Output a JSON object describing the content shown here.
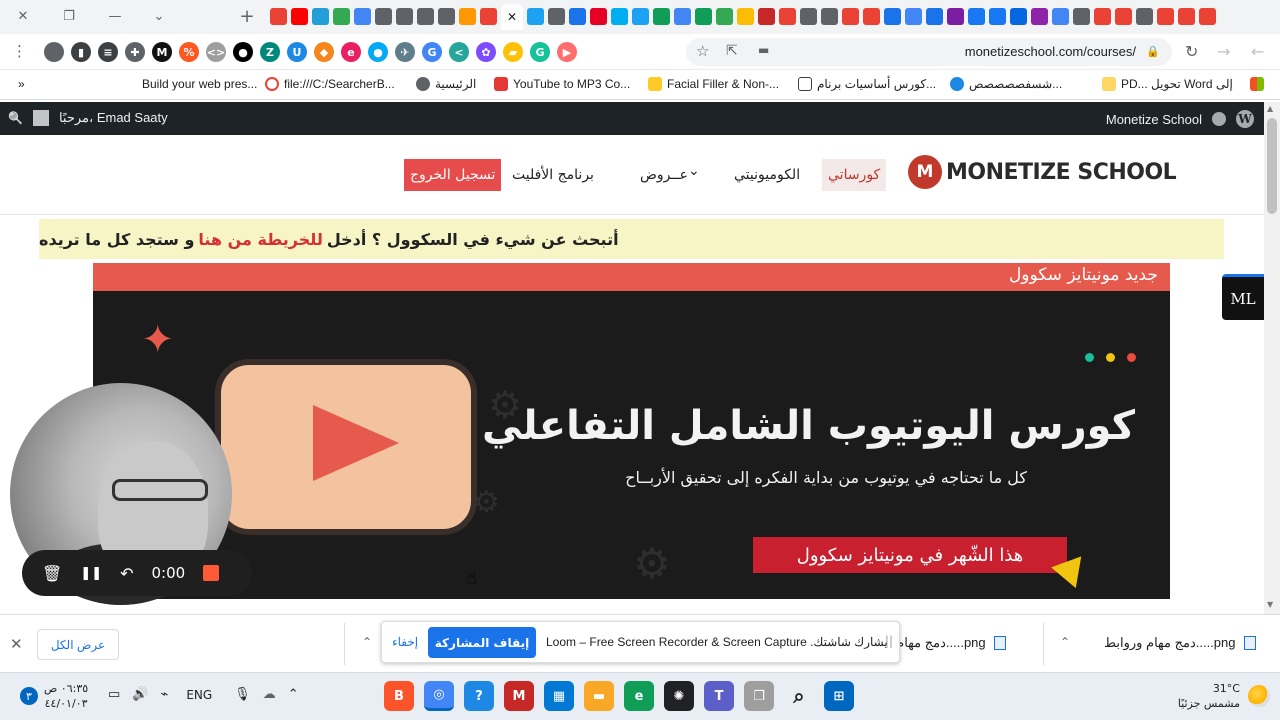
{
  "window": {
    "close_symbol": "✕",
    "restore_symbol": "❐",
    "minimize_symbol": "—",
    "tab_list_symbol": "⌄",
    "new_tab_symbol": "+",
    "active_tab_close_symbol": "✕"
  },
  "tabs": {
    "favicon_colors": [
      "#ea4335",
      "#ff0000",
      "#229ed9",
      "#34a853",
      "#4285f4",
      "#5f6368",
      "#5f6368",
      "#5f6368",
      "#5f6368",
      "#ff9800",
      "#ea4335",
      "#ffffff",
      "#1da1f2",
      "#5f6368",
      "#1a73e8",
      "#e60023",
      "#00aff0",
      "#1da1f2",
      "#0f9d58",
      "#4285f4",
      "#0f9d58",
      "#34a853",
      "#fbbc04",
      "#c62828",
      "#ea4335",
      "#5f6368",
      "#5f6368",
      "#ea4335",
      "#ea4335",
      "#1a73e8",
      "#4285f4",
      "#1a73e8",
      "#7b1fa2",
      "#1877f2",
      "#1877f2",
      "#0668e1",
      "#8e24aa",
      "#4285f4",
      "#5f6368",
      "#ea4335",
      "#ea4335",
      "#5f6368",
      "#ea4335",
      "#ea4335",
      "#ea4335"
    ]
  },
  "toolbar": {
    "url": "monetizeschool.com/courses/",
    "star_symbol": "☆",
    "share_symbol": "⇱",
    "cast_symbol": "▬",
    "lock_symbol": "🔒",
    "reload_symbol": "↻",
    "back_symbol": "←",
    "forward_symbol": "→",
    "menu_symbol": "⋮",
    "extensions": [
      {
        "name": "profile-extension-icon",
        "color": "#5f6368",
        "glyph": ""
      },
      {
        "name": "sidepanel-icon",
        "color": "#3c4043",
        "glyph": "▮"
      },
      {
        "name": "reading-list-icon",
        "color": "#3c4043",
        "glyph": "≡"
      },
      {
        "name": "puzzle-icon",
        "color": "#5f6368",
        "glyph": "✚"
      },
      {
        "name": "loom-icon",
        "color": "#111111",
        "glyph": "M"
      },
      {
        "name": "percent-icon",
        "color": "#ff5722",
        "glyph": "%"
      },
      {
        "name": "code-icon",
        "color": "#9e9e9e",
        "glyph": "<>"
      },
      {
        "name": "dot-icon",
        "color": "#000000",
        "glyph": "●"
      },
      {
        "name": "z-icon",
        "color": "#00897b",
        "glyph": "Z"
      },
      {
        "name": "u-icon",
        "color": "#1e88e5",
        "glyph": "U"
      },
      {
        "name": "metamask-icon",
        "color": "#f6851b",
        "glyph": "◆"
      },
      {
        "name": "e-icon",
        "color": "#e91e63",
        "glyph": "e"
      },
      {
        "name": "drop-icon",
        "color": "#03a9f4",
        "glyph": "●"
      },
      {
        "name": "bird-icon",
        "color": "#607d8b",
        "glyph": "✈"
      },
      {
        "name": "translate-icon",
        "color": "#4285f4",
        "glyph": "G"
      },
      {
        "name": "share-dots-icon",
        "color": "#26a69a",
        "glyph": "<"
      },
      {
        "name": "flower-icon",
        "color": "#7c4dff",
        "glyph": "✿"
      },
      {
        "name": "lamp-icon",
        "color": "#ffc107",
        "glyph": "▰"
      },
      {
        "name": "grammarly-icon",
        "color": "#15c39a",
        "glyph": "G"
      },
      {
        "name": "video-icon",
        "color": "#ff6d6d",
        "glyph": "▶"
      }
    ]
  },
  "bookmarks": {
    "overflow": "»",
    "items": [
      {
        "label": "Build your web pres...",
        "color": "#ffffff"
      },
      {
        "label": "file:///C:/SearcherB...",
        "color": "#ea4335"
      },
      {
        "label": "الرئيسية",
        "color": "#5f6368"
      },
      {
        "label": "YouTube to MP3 Co...",
        "color": "#e53935"
      },
      {
        "label": "Facial Filler & Non-...",
        "color": "#ffca28"
      },
      {
        "label": "كورس أساسيات برنام...",
        "color": "#3c4043"
      },
      {
        "label": "شسفصصصصص...",
        "color": "#1e88e5"
      },
      {
        "label": "PD... تحويل Word إلى",
        "color": "#fdd663"
      },
      {
        "label": "",
        "color": "#4caf50"
      }
    ]
  },
  "wpbar": {
    "greeting": "مرحبًا، Emad Saaty",
    "site_name": "Monetize School",
    "search_symbol": "🔍",
    "wp_logo": "W"
  },
  "site": {
    "logo_mark": "M",
    "logo_part1": "MONETIZE ",
    "logo_part2": "SCHOOL",
    "nav": {
      "courses": "كورساتي",
      "community": "الكوميونيتي",
      "offers": "عــروض",
      "affiliate": "برنامج الأفليت",
      "logout": "تسجيل الخروج"
    },
    "chevron": "⌄"
  },
  "notice": {
    "part1": "أتبحث عن شيء في السكوول ؟ أدخل ",
    "link": "للخريطة من هنا",
    "part2": " و ستجد كل ما تريده"
  },
  "banner": {
    "strip_text": "جديد مونيتايز سكوول",
    "title": "كورس اليوتيوب الشامل التفاعلي",
    "subtitle": "كل ما تحتاجه في يوتيوب من بداية الفكره إلى تحقيق الأربــاح",
    "cta": "هذا الشّهر في مونيتايز سكوول",
    "dot_colors": [
      "#1abc9c",
      "#f1c40f",
      "#e74c3c"
    ],
    "star_color": "#e55a4c"
  },
  "loom_tab": {
    "glyph": "ML"
  },
  "recorder": {
    "time": "0:00",
    "delete_symbol": "🗑",
    "pause_symbol": "❚❚",
    "undo_symbol": "↶"
  },
  "downloads": {
    "close_symbol": "✕",
    "show_all": "عرض الكل",
    "item1": "png.....دمج مهام وروابط",
    "item2": "png.....دمج مهام ور",
    "chevron": "⌃"
  },
  "share_bar": {
    "hide": "إخفاء",
    "stop": "إيقاف المشاركة",
    "text": "Loom – Free Screen Recorder & Screen Capture .يشارك شاشتك",
    "grip": "||"
  },
  "taskbar": {
    "time": "٠٦:٣٥ ص",
    "date": "٤٤/٠١/٠٣",
    "badge": "٣",
    "lang": "ENG",
    "battery_symbol": "▭",
    "volume_symbol": "🔊",
    "network_symbol": "⌁",
    "mic_symbol": "🎙",
    "cloud_symbol": "☁",
    "tray_up_symbol": "⌃",
    "temperature": "31°C",
    "weather_desc": "مشمس جزئيًا",
    "apps": [
      {
        "name": "brave-app-icon",
        "color": "#fb542b",
        "glyph": "B",
        "active": false
      },
      {
        "name": "chrome-app-icon",
        "color": "#4285f4",
        "glyph": "◎",
        "active": true
      },
      {
        "name": "help-app-icon",
        "color": "#1e88e5",
        "glyph": "?",
        "active": false
      },
      {
        "name": "mcafee-app-icon",
        "color": "#c62828",
        "glyph": "M",
        "active": false
      },
      {
        "name": "store-app-icon",
        "color": "#0078d4",
        "glyph": "▦",
        "active": false
      },
      {
        "name": "explorer-app-icon",
        "color": "#f9a825",
        "glyph": "▬",
        "active": false
      },
      {
        "name": "edge-app-icon",
        "color": "#0f9d58",
        "glyph": "e",
        "active": false
      },
      {
        "name": "chatgpt-app-icon",
        "color": "#202124",
        "glyph": "✺",
        "active": false
      },
      {
        "name": "teams-app-icon",
        "color": "#5b5fc7",
        "glyph": "T",
        "active": false
      },
      {
        "name": "window-app-icon",
        "color": "#9e9e9e",
        "glyph": "❐",
        "active": false
      },
      {
        "name": "search-app-icon",
        "color": "#e9eef5",
        "glyph": "⌕",
        "active": false
      },
      {
        "name": "start-app-icon",
        "color": "#0067c0",
        "glyph": "⊞",
        "active": false
      }
    ]
  }
}
